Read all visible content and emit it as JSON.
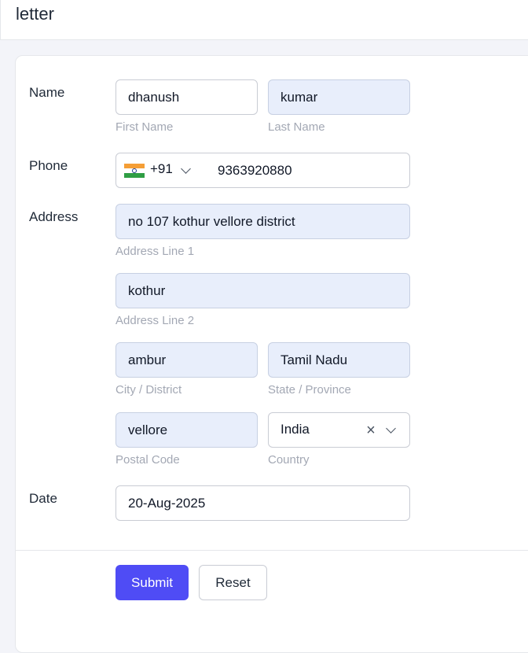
{
  "header": {
    "title": "letter"
  },
  "form": {
    "name": {
      "label": "Name",
      "first_value": "dhanush",
      "first_hint": "First Name",
      "last_value": "kumar",
      "last_hint": "Last Name"
    },
    "phone": {
      "label": "Phone",
      "flag_icon": "india-flag-icon",
      "dial_code": "+91",
      "number": "9363920880"
    },
    "address": {
      "label": "Address",
      "line1_value": "no 107 kothur vellore district",
      "line1_hint": "Address Line 1",
      "line2_value": "kothur",
      "line2_hint": "Address Line 2",
      "city_value": "ambur",
      "city_hint": "City / District",
      "state_value": "Tamil Nadu",
      "state_hint": "State / Province",
      "postal_value": "vellore",
      "postal_hint": "Postal Code",
      "country_value": "India",
      "country_hint": "Country"
    },
    "date": {
      "label": "Date",
      "value": "20-Aug-2025"
    }
  },
  "actions": {
    "submit_label": "Submit",
    "reset_label": "Reset"
  },
  "colors": {
    "accent": "#4f4cf5",
    "autofill_bg": "#e8eefb",
    "hint": "#a3a8b4"
  }
}
